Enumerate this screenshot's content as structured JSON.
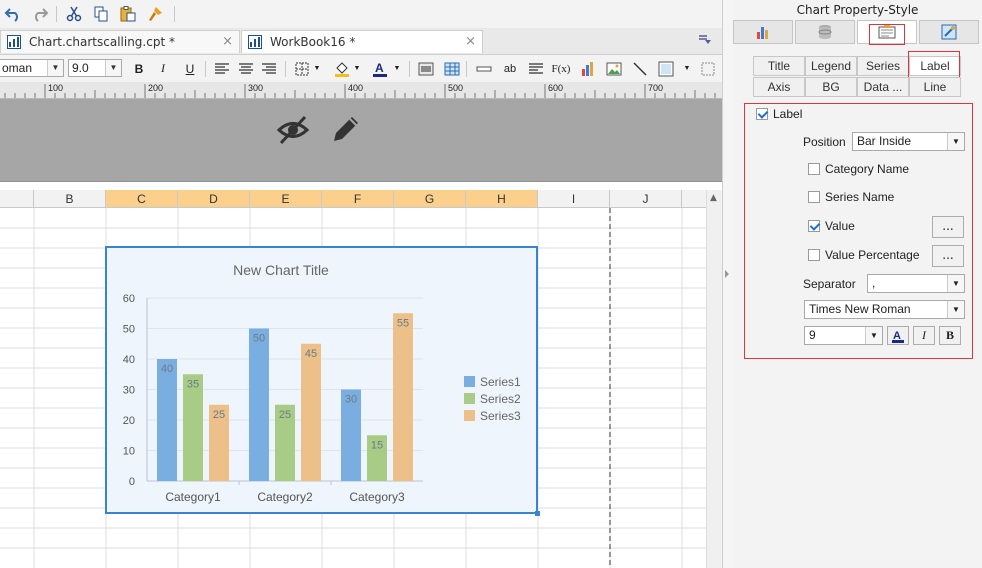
{
  "tabs": [
    {
      "label": "Chart.chartscalling.cpt *"
    },
    {
      "label": "WorkBook16 *"
    }
  ],
  "format": {
    "font_name": "oman",
    "font_size": "9.0",
    "bold": "B",
    "italic": "I",
    "underline": "U",
    "label_btn": "ab",
    "fx_btn": "F(x)"
  },
  "ruler": {
    "ticks": [
      "100",
      "200",
      "300",
      "400",
      "500",
      "600",
      "700"
    ]
  },
  "columns": [
    "B",
    "C",
    "D",
    "E",
    "F",
    "G",
    "H",
    "I",
    "J"
  ],
  "chart_data": {
    "type": "bar",
    "title": "New Chart Title",
    "categories": [
      "Category1",
      "Category2",
      "Category3"
    ],
    "series": [
      {
        "name": "Series1",
        "values": [
          40,
          50,
          30
        ],
        "color": "#7aaee0"
      },
      {
        "name": "Series2",
        "values": [
          35,
          25,
          15
        ],
        "color": "#a8cc86"
      },
      {
        "name": "Series3",
        "values": [
          25,
          45,
          55
        ],
        "color": "#ecc088"
      }
    ],
    "ylim": [
      0,
      60
    ],
    "yticks": [
      "0",
      "10",
      "20",
      "30",
      "40",
      "50",
      "60"
    ],
    "grid": true,
    "legend": "right",
    "data_labels": "bar inside"
  },
  "panel": {
    "title": "Chart Property-Style",
    "subtabs_row1": [
      "Title",
      "Legend",
      "Series",
      "Label"
    ],
    "subtabs_row2": [
      "Axis",
      "BG",
      "Data ...",
      "Line"
    ],
    "label_checkbox": "Label",
    "position_label": "Position",
    "position_value": "Bar Inside",
    "category_name": "Category Name",
    "series_name": "Series Name",
    "value": "Value",
    "value_percentage": "Value Percentage",
    "dots": "...",
    "separator_label": "Separator",
    "separator_value": ",",
    "font_family": "Times New Roman",
    "font_size": "9",
    "italic": "I",
    "bold": "B"
  }
}
